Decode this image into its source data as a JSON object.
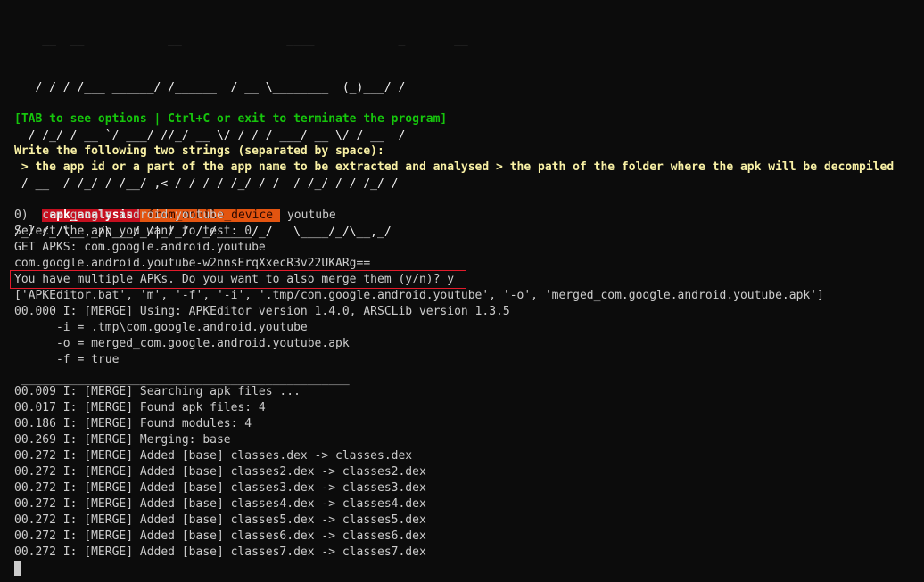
{
  "ascii_banner": [
    "    __  __            __               ____            _       __",
    "   / / / /___ ______/ /______  / __ \\________  (_)___/ /",
    "  / /_/ / __ `/ ___/ //_/ __ \\/ / / / ___/ __ \\/ / __  /",
    " / __  / /_/ / /__/ ,< / / / / /_/ / /  / /_/ / / /_/ /",
    "/_/ /_/\\__,_/\\___/_/|_/_/ /_/_____/_/   \\____/_/\\__,_/"
  ],
  "tab_hint": "[TAB to see options | Ctrl+C or exit to terminate the program]",
  "instruction_title": "Write the following two strings (separated by space):",
  "instruction_detail": " > the app id or a part of the app name to be extracted and analysed > the path of the folder where the apk will be decompiled",
  "prompt": {
    "segment1": "apk_analysis",
    "segment2": "from_mobile_device",
    "input": " youtube"
  },
  "output_lines": [
    "0)  com.google.android.youtube",
    "Select the app you want to test: 0",
    "GET APKS: com.google.android.youtube",
    "com.google.android.youtube-w2nnsErqXxecR3v22UKARg==",
    "You have multiple APKs. Do you want to also merge them (y/n)? y",
    "['APKEditor.bat', 'm', '-f', '-i', '.tmp/com.google.android.youtube', '-o', 'merged_com.google.android.youtube.apk']",
    "00.000 I: [MERGE] Using: APKEditor version 1.4.0, ARSCLib version 1.3.5",
    "      -i = .tmp\\com.google.android.youtube",
    "      -o = merged_com.google.android.youtube.apk",
    "      -f = true",
    "",
    " _______________________________________________",
    "00.009 I: [MERGE] Searching apk files ...",
    "00.017 I: [MERGE] Found apk files: 4",
    "00.186 I: [MERGE] Found modules: 4",
    "00.269 I: [MERGE] Merging: base",
    "00.272 I: [MERGE] Added [base] classes.dex -> classes.dex",
    "00.272 I: [MERGE] Added [base] classes2.dex -> classes2.dex",
    "00.272 I: [MERGE] Added [base] classes3.dex -> classes3.dex",
    "00.272 I: [MERGE] Added [base] classes4.dex -> classes4.dex",
    "00.272 I: [MERGE] Added [base] classes5.dex -> classes5.dex",
    "00.272 I: [MERGE] Added [base] classes6.dex -> classes6.dex",
    "00.272 I: [MERGE] Added [base] classes7.dex -> classes7.dex"
  ],
  "colors": {
    "background": "#0c0c0c",
    "text": "#cccccc",
    "hint_green": "#16c60c",
    "instruction_yellow": "#f9f1a5",
    "prompt_red": "#c50f1f",
    "prompt_orange": "#e35410",
    "highlight_border": "#e21b2b"
  }
}
